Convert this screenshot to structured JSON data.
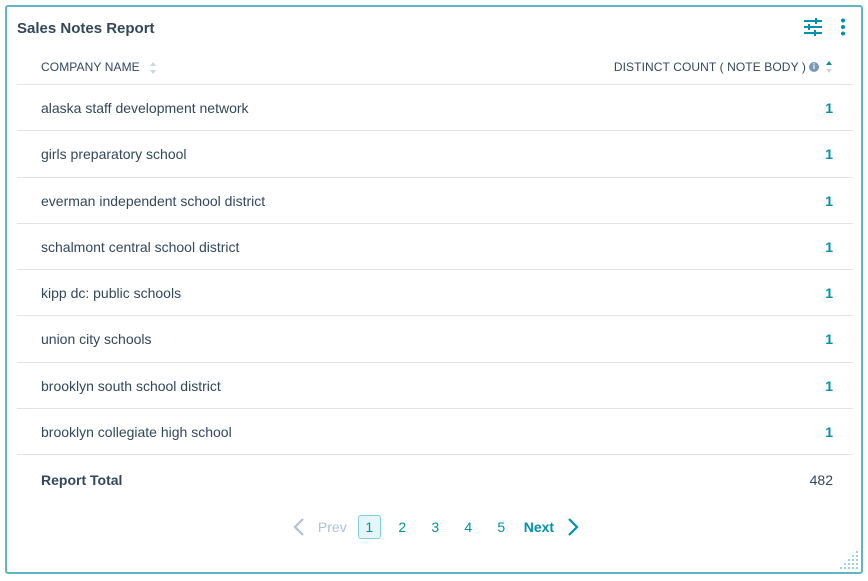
{
  "report": {
    "title": "Sales Notes Report"
  },
  "table": {
    "columns": {
      "company": "COMPANY NAME",
      "count": "DISTINCT COUNT ( NOTE BODY )"
    },
    "rows": [
      {
        "company": "alaska staff development network",
        "count": "1"
      },
      {
        "company": "girls preparatory school",
        "count": "1"
      },
      {
        "company": "everman independent school district",
        "count": "1"
      },
      {
        "company": "schalmont central school district",
        "count": "1"
      },
      {
        "company": "kipp dc: public schools",
        "count": "1"
      },
      {
        "company": "union city schools",
        "count": "1"
      },
      {
        "company": "brooklyn south school district",
        "count": "1"
      },
      {
        "company": "brooklyn collegiate high school",
        "count": "1"
      }
    ],
    "total": {
      "label": "Report Total",
      "value": "482"
    }
  },
  "pagination": {
    "prev_label": "Prev",
    "next_label": "Next",
    "pages": [
      "1",
      "2",
      "3",
      "4",
      "5"
    ],
    "current": "1"
  },
  "icons": {
    "filter": "sliders-icon",
    "more": "vertical-dots-icon",
    "info": "info-icon",
    "sort": "sort-icon",
    "resize": "resize-grip-icon"
  },
  "colors": {
    "border": "#5fb6c7",
    "accent": "#0091ae",
    "text": "#33475b",
    "muted": "#b0c1d4"
  }
}
